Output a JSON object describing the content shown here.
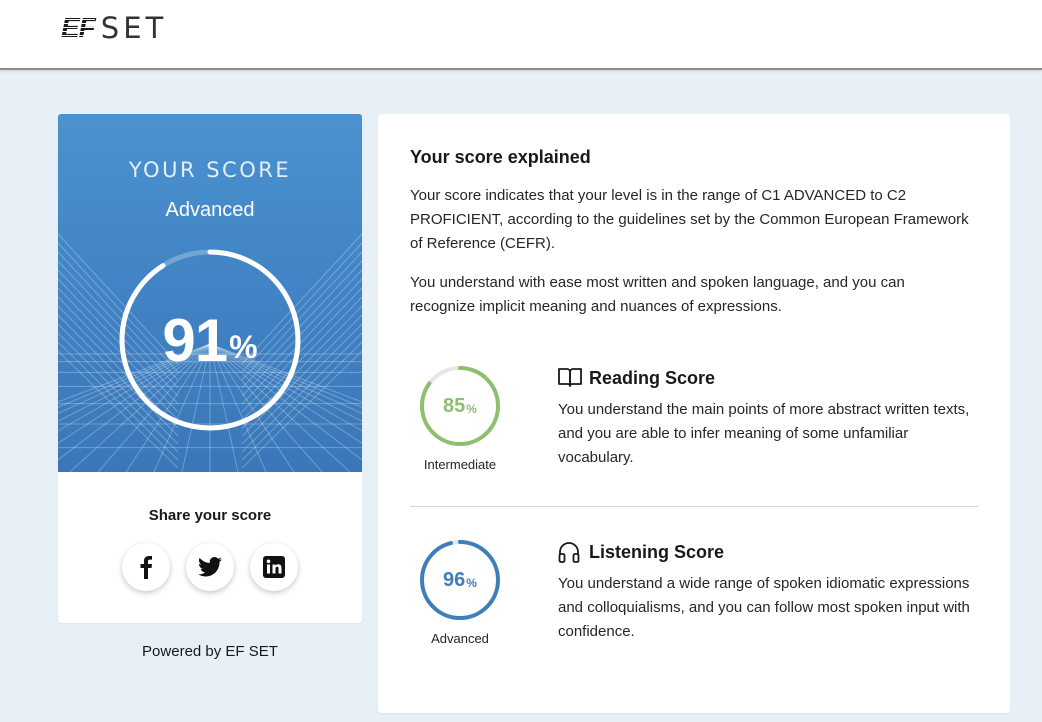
{
  "header": {
    "logo_mark": "EF",
    "logo_text": "SET"
  },
  "score_card": {
    "heading": "YOUR SCORE",
    "level": "Advanced",
    "score": 91,
    "score_display": "91",
    "percent_symbol": "%",
    "ring_color": "#ffffff",
    "share_title": "Share your score",
    "share_buttons": [
      {
        "name": "facebook-icon"
      },
      {
        "name": "twitter-icon"
      },
      {
        "name": "linkedin-icon"
      }
    ]
  },
  "powered_by": "Powered by EF SET",
  "explanation": {
    "title": "Your score explained",
    "paragraph_1": "Your score indicates that your level is in the range of C1 ADVANCED to C2 PROFICIENT, according to the guidelines set by the Common European Framework of Reference (CEFR).",
    "paragraph_2": "You understand with ease most written and spoken language, and you can recognize implicit meaning and nuances of expressions.",
    "reading": {
      "title": "Reading Score",
      "icon": "book-icon",
      "score": 85,
      "score_display": "85",
      "percent_symbol": "%",
      "level": "Intermediate",
      "color": "#8dbf6e",
      "description": "You understand the main points of more abstract written texts, and you are able to infer meaning of some unfamiliar vocabulary."
    },
    "listening": {
      "title": "Listening Score",
      "icon": "headphones-icon",
      "score": 96,
      "score_display": "96",
      "percent_symbol": "%",
      "level": "Advanced",
      "color": "#3f7fb9",
      "description": "You understand a wide range of spoken idiomatic expressions and colloquialisms, and you can follow most spoken input with confidence."
    }
  }
}
